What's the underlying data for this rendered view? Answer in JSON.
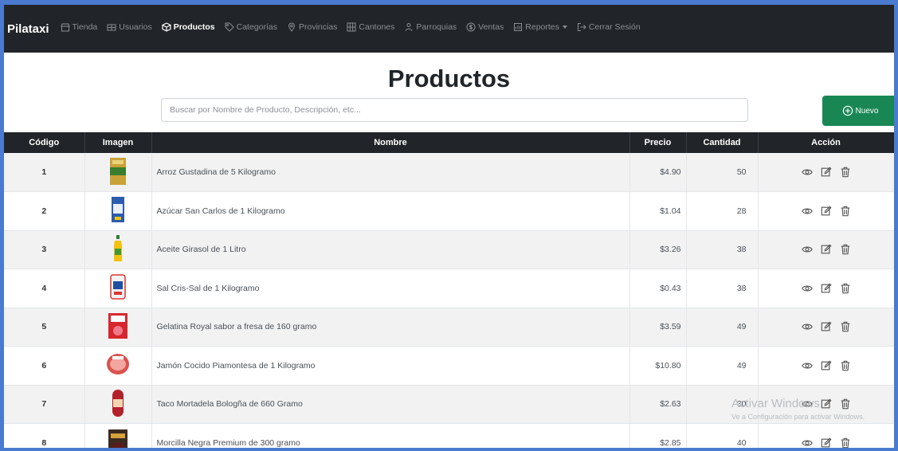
{
  "navbar": {
    "brand": "Pilataxi",
    "items": [
      {
        "label": "Tienda",
        "icon": "store-icon",
        "active": false
      },
      {
        "label": "Usuarios",
        "icon": "users-icon",
        "active": false
      },
      {
        "label": "Productos",
        "icon": "box-icon",
        "active": true
      },
      {
        "label": "Categorías",
        "icon": "tag-icon",
        "active": false
      },
      {
        "label": "Provincias",
        "icon": "map-pin-icon",
        "active": false
      },
      {
        "label": "Cantones",
        "icon": "grid-icon",
        "active": false
      },
      {
        "label": "Parroquias",
        "icon": "people-icon",
        "active": false
      },
      {
        "label": "Ventas",
        "icon": "dollar-icon",
        "active": false
      },
      {
        "label": "Reportes",
        "icon": "report-icon",
        "active": false,
        "dropdown": true
      },
      {
        "label": "Cerrar Sesión",
        "icon": "logout-icon",
        "active": false
      }
    ]
  },
  "page": {
    "title": "Productos",
    "search_placeholder": "Buscar por Nombre de Producto, Descripción, etc...",
    "new_button_label": "Nuevo"
  },
  "table": {
    "headers": {
      "code": "Código",
      "image": "Imagen",
      "name": "Nombre",
      "price": "Precio",
      "quantity": "Cantidad",
      "action": "Acción"
    },
    "rows": [
      {
        "code": "1",
        "name": "Arroz Gustadina de 5 Kilogramo",
        "price": "$4.90",
        "quantity": "50",
        "thumb": "rice-bag"
      },
      {
        "code": "2",
        "name": "Azúcar San Carlos de 1 Kilogramo",
        "price": "$1.04",
        "quantity": "28",
        "thumb": "sugar-bag"
      },
      {
        "code": "3",
        "name": "Aceite Girasol de 1 Litro",
        "price": "$3.26",
        "quantity": "38",
        "thumb": "oil-bottle"
      },
      {
        "code": "4",
        "name": "Sal Cris-Sal de 1 Kilogramo",
        "price": "$0.43",
        "quantity": "38",
        "thumb": "salt-bag"
      },
      {
        "code": "5",
        "name": "Gelatina Royal sabor a fresa de 160 gramo",
        "price": "$3.59",
        "quantity": "49",
        "thumb": "gelatin-box"
      },
      {
        "code": "6",
        "name": "Jamón Cocido Piamontesa de 1 Kilogramo",
        "price": "$10.80",
        "quantity": "49",
        "thumb": "ham-pack"
      },
      {
        "code": "7",
        "name": "Taco Mortadela Bologña de 660 Gramo",
        "price": "$2.63",
        "quantity": "30",
        "thumb": "mortadella"
      },
      {
        "code": "8",
        "name": "Morcilla Negra Premium de 300 gramo",
        "price": "$2.85",
        "quantity": "40",
        "thumb": "sausage-pack"
      }
    ]
  },
  "watermark": {
    "title": "Activar Windows",
    "subtitle": "Ve a Configuración para activar Windows."
  },
  "colors": {
    "navbar_bg": "#212529",
    "accent_green": "#198754",
    "frame_blue": "#4a7bd0"
  }
}
